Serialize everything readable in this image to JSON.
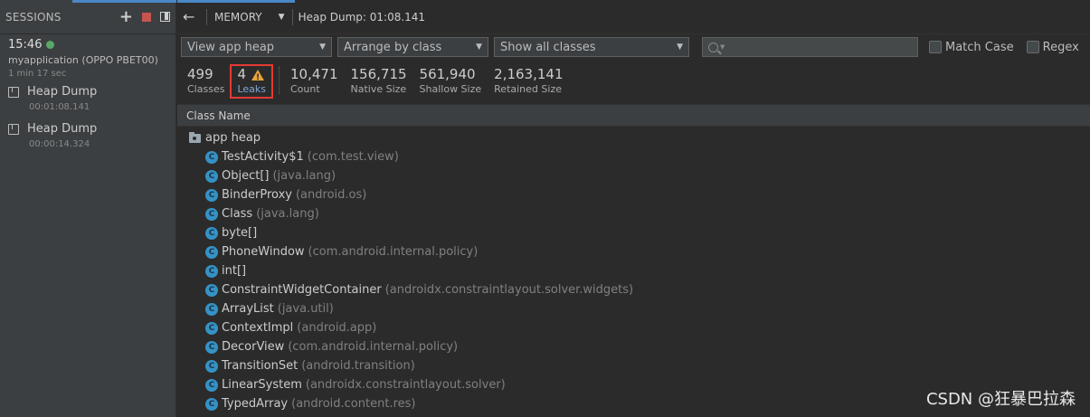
{
  "sidebar": {
    "title": "SESSIONS",
    "session": {
      "time": "15:46",
      "device": "myapplication (OPPO PBET00)",
      "duration": "1 min 17 sec"
    },
    "heap_dumps": [
      {
        "label": "Heap Dump",
        "time": "00:01:08.141"
      },
      {
        "label": "Heap Dump",
        "time": "00:00:14.324"
      }
    ]
  },
  "toolbar": {
    "profiler": "MEMORY",
    "title": "Heap Dump: 01:08.141"
  },
  "filters": {
    "heap": "View app heap",
    "arrange": "Arrange by class",
    "show": "Show all classes",
    "search_placeholder": "",
    "match_case": "Match Case",
    "regex": "Regex"
  },
  "stats": {
    "classes": {
      "value": "499",
      "label": "Classes"
    },
    "leaks": {
      "value": "4",
      "label": "Leaks"
    },
    "count": {
      "value": "10,471",
      "label": "Count"
    },
    "native": {
      "value": "156,715",
      "label": "Native Size"
    },
    "shallow": {
      "value": "561,940",
      "label": "Shallow Size"
    },
    "retained": {
      "value": "2,163,141",
      "label": "Retained Size"
    }
  },
  "table": {
    "column": "Class Name",
    "root": "app heap",
    "rows": [
      {
        "name": "TestActivity$1",
        "pkg": "(com.test.view)"
      },
      {
        "name": "Object[]",
        "pkg": "(java.lang)"
      },
      {
        "name": "BinderProxy",
        "pkg": "(android.os)"
      },
      {
        "name": "Class",
        "pkg": "(java.lang)"
      },
      {
        "name": "byte[]",
        "pkg": ""
      },
      {
        "name": "PhoneWindow",
        "pkg": "(com.android.internal.policy)"
      },
      {
        "name": "int[]",
        "pkg": ""
      },
      {
        "name": "ConstraintWidgetContainer",
        "pkg": "(androidx.constraintlayout.solver.widgets)"
      },
      {
        "name": "ArrayList",
        "pkg": "(java.util)"
      },
      {
        "name": "ContextImpl",
        "pkg": "(android.app)"
      },
      {
        "name": "DecorView",
        "pkg": "(com.android.internal.policy)"
      },
      {
        "name": "TransitionSet",
        "pkg": "(android.transition)"
      },
      {
        "name": "LinearSystem",
        "pkg": "(androidx.constraintlayout.solver)"
      },
      {
        "name": "TypedArray",
        "pkg": "(android.content.res)"
      }
    ]
  },
  "class_icon_letter": "C",
  "watermark": "CSDN @狂暴巴拉森",
  "colors": {
    "accent": "#4a88c7",
    "live": "#59a869",
    "leak_highlight": "#e53935",
    "warning": "#e8a33d",
    "class_icon": "#3592c4"
  }
}
